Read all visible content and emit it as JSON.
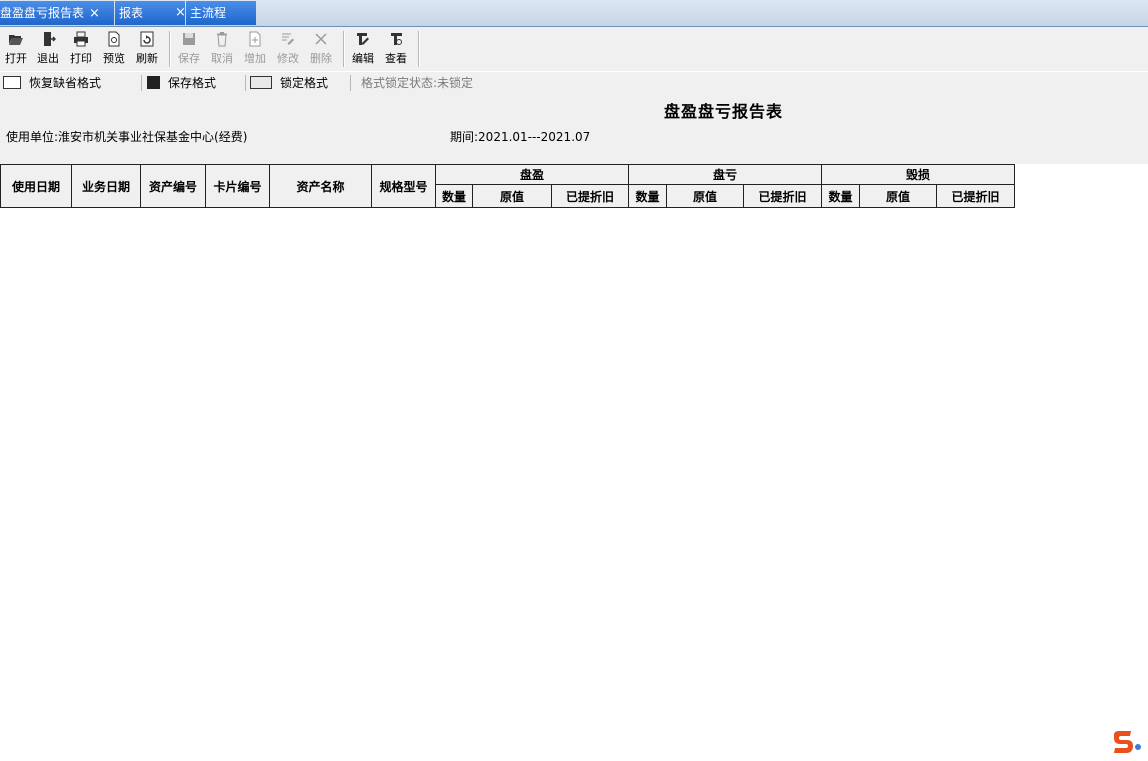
{
  "tabs": [
    {
      "label": "盘盈盘亏报告表",
      "close": "×"
    },
    {
      "label": "报表",
      "close": "×"
    },
    {
      "label": "主流程"
    }
  ],
  "toolbar": {
    "open": "打开",
    "exit": "退出",
    "print": "打印",
    "preview": "预览",
    "refresh": "刷新",
    "save": "保存",
    "cancel": "取消",
    "add": "增加",
    "modify": "修改",
    "delete": "删除",
    "edit": "编辑",
    "view": "查看"
  },
  "formatbar": {
    "restore_default": "恢复缺省格式",
    "save_format": "保存格式",
    "lock_format": "锁定格式",
    "lock_status": "格式锁定状态:未锁定"
  },
  "report": {
    "title": "盘盈盘亏报告表",
    "unit": "使用单位:淮安市机关事业社保基金中心(经费)",
    "period": "期间:2021.01---2021.07"
  },
  "table": {
    "columns": [
      "使用日期",
      "业务日期",
      "资产编号",
      "卡片编号",
      "资产名称",
      "规格型号"
    ],
    "groups": [
      {
        "label": "盘盈",
        "sub": [
          "数量",
          "原值",
          "已提折旧"
        ]
      },
      {
        "label": "盘亏",
        "sub": [
          "数量",
          "原值",
          "已提折旧"
        ]
      },
      {
        "label": "毁损",
        "sub": [
          "数量",
          "原值",
          "已提折旧"
        ]
      }
    ]
  },
  "colors": {
    "tab_active": "#1f66cc",
    "toolbar_bg": "#f0f0f0"
  }
}
